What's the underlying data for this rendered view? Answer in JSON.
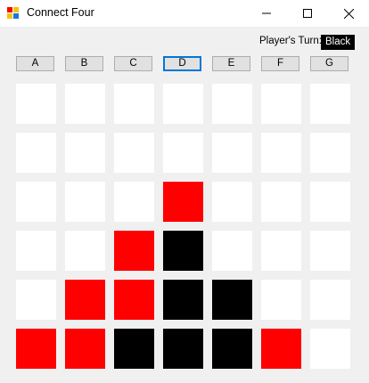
{
  "window": {
    "title": "Connect Four"
  },
  "icons": {
    "app": "app-icon",
    "minimize": "minimize-icon",
    "maximize": "maximize-icon",
    "close": "close-icon"
  },
  "status": {
    "turn_label": "Player's Turn:",
    "turn_value": "Black"
  },
  "columns": [
    "A",
    "B",
    "C",
    "D",
    "E",
    "F",
    "G"
  ],
  "selected_column": "D",
  "colors": {
    "empty": "#ffffff",
    "red": "#ff0000",
    "black": "#000000",
    "background": "#f0f0f0"
  },
  "board": [
    [
      "empty",
      "empty",
      "empty",
      "empty",
      "empty",
      "empty",
      "empty"
    ],
    [
      "empty",
      "empty",
      "empty",
      "empty",
      "empty",
      "empty",
      "empty"
    ],
    [
      "empty",
      "empty",
      "empty",
      "red",
      "empty",
      "empty",
      "empty"
    ],
    [
      "empty",
      "empty",
      "red",
      "black",
      "empty",
      "empty",
      "empty"
    ],
    [
      "empty",
      "red",
      "red",
      "black",
      "black",
      "empty",
      "empty"
    ],
    [
      "red",
      "red",
      "black",
      "black",
      "black",
      "red",
      "empty"
    ]
  ]
}
